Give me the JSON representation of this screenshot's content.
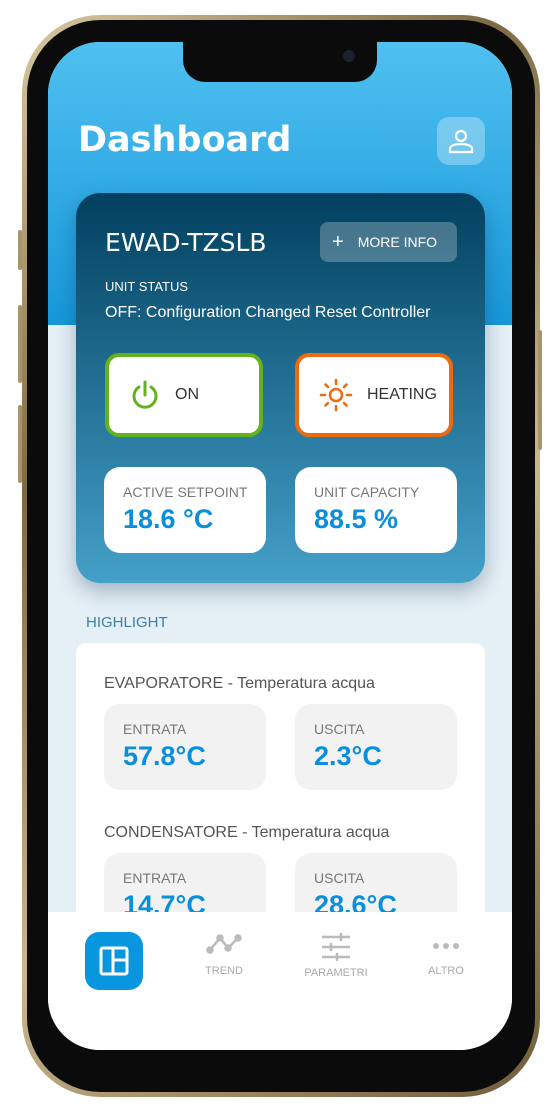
{
  "header": {
    "title": "Dashboard",
    "profile_icon": "user-icon"
  },
  "unit_card": {
    "model": "EWAD-TZSLB",
    "more_info": "MORE INFO",
    "status_label": "UNIT STATUS",
    "status": "OFF: Configuration Changed Reset Controller",
    "power": {
      "label": "ON",
      "icon": "power-icon",
      "color": "#62b21c"
    },
    "mode": {
      "label": "HEATING",
      "icon": "sun-icon",
      "color": "#ee6a10"
    },
    "setpoint": {
      "label": "ACTIVE SETPOINT",
      "value": "18.6 °C"
    },
    "capacity": {
      "label": "UNIT CAPACITY",
      "value": "88.5 %"
    }
  },
  "highlight": {
    "title": "HIGHLIGHT",
    "evaporatore": {
      "title": "EVAPORATORE - Temperatura acqua",
      "in_label": "ENTRATA",
      "in_value": "57.8°C",
      "out_label": "USCITA",
      "out_value": "2.3°C"
    },
    "condensatore": {
      "title": "CONDENSATORE - Temperatura acqua",
      "in_label": "ENTRATA",
      "in_value": "14.7°C",
      "out_label": "USCITA",
      "out_value": "28.6°C"
    }
  },
  "nav": {
    "items": [
      {
        "label": "",
        "icon": "dashboard-icon",
        "active": true
      },
      {
        "label": "TREND",
        "icon": "trend-icon"
      },
      {
        "label": "PARAMETRI",
        "icon": "sliders-icon"
      },
      {
        "label": "ALTRO",
        "icon": "more-icon"
      }
    ]
  },
  "colors": {
    "accent": "#0896de",
    "card_top": "#02405f",
    "card_bottom": "#44a0c9"
  }
}
